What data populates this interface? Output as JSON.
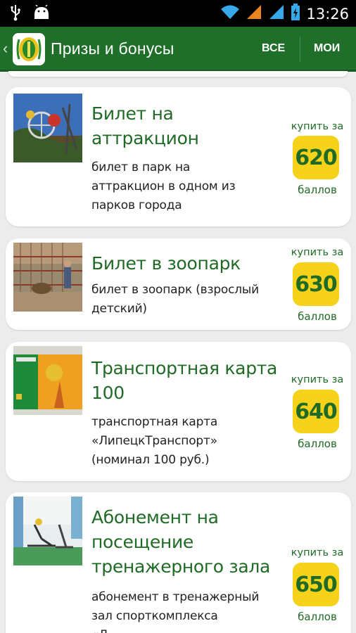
{
  "status_bar": {
    "time": "13:26",
    "icons": [
      "usb-icon",
      "android-debug-icon",
      "wifi-icon",
      "signal-icon",
      "signal-icon",
      "battery-icon"
    ]
  },
  "action_bar": {
    "title": "Призы и бонусы",
    "btn_all": "ВСЕ",
    "btn_mine": "МОИ",
    "colors": {
      "bar": "#1f6f2b",
      "price_badge": "#f7d21b",
      "text_green": "#1f6b25"
    }
  },
  "cards": [
    {
      "title_lines": [
        "Билет на",
        "аттракцион"
      ],
      "desc_lines": [
        "билет в парк на",
        "аттракцион в одном из",
        "парков города"
      ],
      "buy_label": "купить за",
      "price": "620",
      "points_label": "баллов"
    },
    {
      "title_lines": [
        "Билет в зоопарк"
      ],
      "desc_lines": [
        "билет в зоопарк (взрослый",
        "детский)"
      ],
      "buy_label": "купить за",
      "price": "630",
      "points_label": "баллов"
    },
    {
      "title_lines": [
        "Транспортная карта",
        "100"
      ],
      "desc_lines": [
        "транспортная карта",
        "«ЛипецкТранспорт»",
        "(номинал 100 руб.)"
      ],
      "buy_label": "купить за",
      "price": "640",
      "points_label": "баллов"
    },
    {
      "title_lines": [
        "Абонемент на",
        "посещение",
        "тренажерного зала"
      ],
      "desc_lines": [
        "абонемент в тренажерный",
        "зал спорткомплекса",
        "«Л..."
      ],
      "buy_label": "купить за",
      "price": "650",
      "points_label": "баллов"
    }
  ]
}
